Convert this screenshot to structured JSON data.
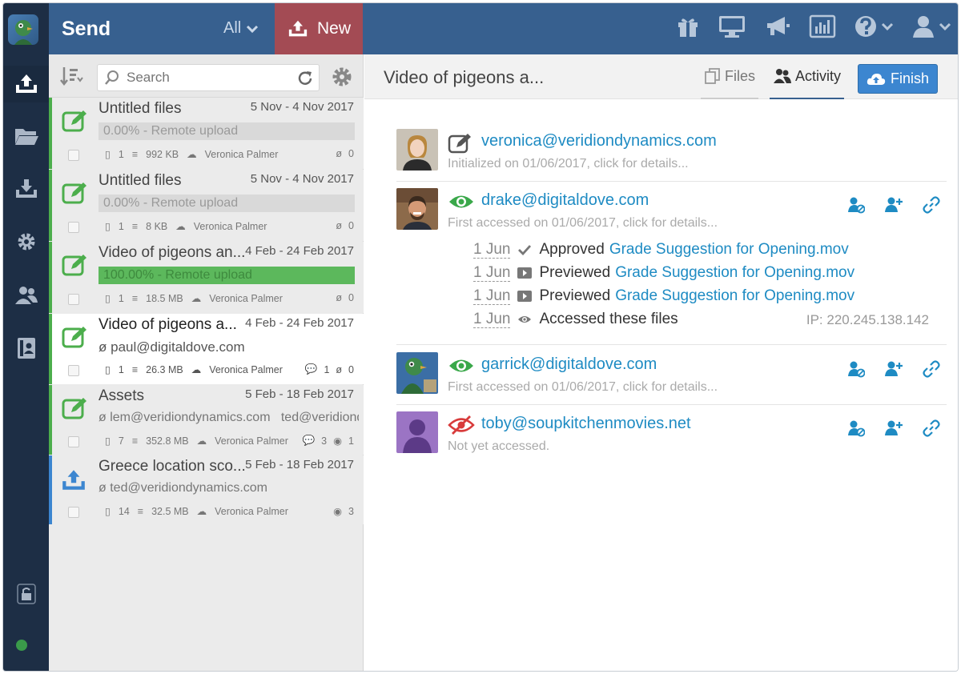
{
  "topbar": {
    "title": "Send",
    "filter": "All",
    "new_label": "New"
  },
  "search": {
    "placeholder": "Search"
  },
  "items": [
    {
      "title": "Untitled files",
      "dates": "5 Nov - 4 Nov 2017",
      "progress": "0.00% - Remote upload",
      "progress_fraction": 0,
      "files": "1",
      "size": "992 KB",
      "owner": "Veronica Palmer",
      "views": "0"
    },
    {
      "title": "Untitled files",
      "dates": "5 Nov - 4 Nov 2017",
      "progress": "0.00% - Remote upload",
      "progress_fraction": 0,
      "files": "1",
      "size": "8 KB",
      "owner": "Veronica Palmer",
      "views": "0"
    },
    {
      "title": "Video of pigeons an...",
      "dates": "4 Feb - 24 Feb 2017",
      "progress": "100.00% - Remote upload",
      "progress_fraction": 1,
      "files": "1",
      "size": "18.5 MB",
      "owner": "Veronica Palmer",
      "views": "0"
    },
    {
      "title": "Video of pigeons a...",
      "dates": "4 Feb - 24 Feb 2017",
      "recipients": "paul@digitaldove.com",
      "files": "1",
      "size": "26.3 MB",
      "owner": "Veronica Palmer",
      "comments": "1",
      "views": "0"
    },
    {
      "title": "Assets",
      "dates": "5 Feb - 18 Feb 2017",
      "recipients": "lem@veridiondynamics.com   ted@veridiondyna",
      "files": "7",
      "size": "352.8 MB",
      "owner": "Veronica Palmer",
      "comments": "3",
      "views": "1"
    },
    {
      "title": "Greece location sco...",
      "dates": "5 Feb - 18 Feb 2017",
      "recipients": "ted@veridiondynamics.com",
      "files": "14",
      "size": "32.5 MB",
      "owner": "Veronica Palmer",
      "views": "3"
    }
  ],
  "detail": {
    "title": "Video of pigeons a...",
    "tab_files": "Files",
    "tab_activity": "Activity",
    "finish_label": "Finish",
    "activity": [
      {
        "email": "veronica@veridiondynamics.com",
        "sub": "Initialized on 01/06/2017, click for details..."
      },
      {
        "email": "drake@digitaldove.com",
        "sub": "First accessed on 01/06/2017, click for details...",
        "events": [
          {
            "date": "1 Jun",
            "action": "Approved",
            "file": "Grade Suggestion for Opening.mov"
          },
          {
            "date": "1 Jun",
            "action": "Previewed",
            "file": "Grade Suggestion for Opening.mov"
          },
          {
            "date": "1 Jun",
            "action": "Previewed",
            "file": "Grade Suggestion for Opening.mov"
          },
          {
            "date": "1 Jun",
            "action": "Accessed these files",
            "ip": "IP: 220.245.138.142"
          }
        ]
      },
      {
        "email": "garrick@digitaldove.com",
        "sub": "First accessed on 01/06/2017, click for details..."
      },
      {
        "email": "toby@soupkitchenmovies.net",
        "sub": "Not yet accessed."
      }
    ]
  },
  "colors": {
    "topbar": "#37608f",
    "rail": "#1d2e45",
    "new_button": "#a34b54",
    "accent_green": "#4cae4c",
    "link": "#1e8bc3",
    "finish": "#3c86d0"
  }
}
